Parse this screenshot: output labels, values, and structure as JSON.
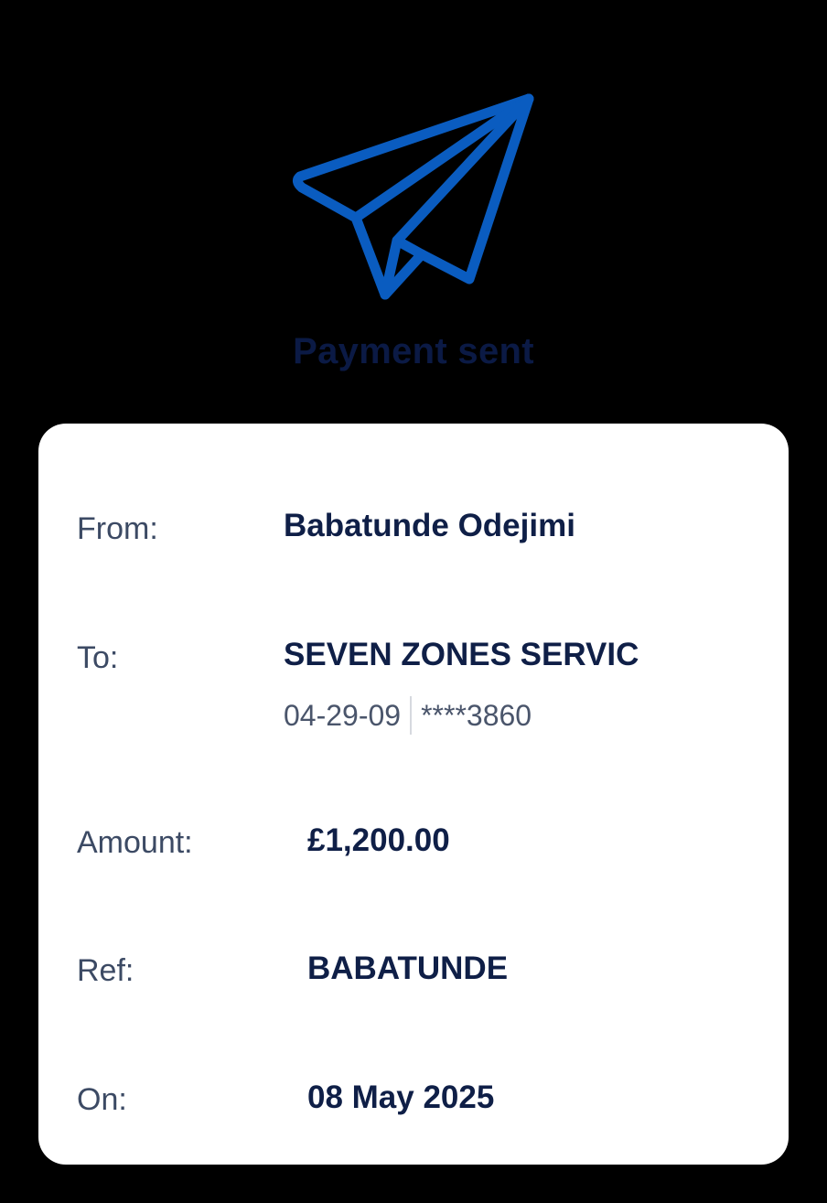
{
  "header": {
    "icon": "paper-plane-icon",
    "title": "Payment sent",
    "accent_color": "#0a5cc0"
  },
  "details": {
    "from": {
      "label": "From:",
      "value": "Babatunde Odejimi"
    },
    "to": {
      "label": "To:",
      "value": "SEVEN ZONES SERVIC",
      "sort_code": "04-29-09",
      "account_number": "****3860"
    },
    "amount": {
      "label": "Amount:",
      "value": "£1,200.00"
    },
    "ref": {
      "label": "Ref:",
      "value": "BABATUNDE"
    },
    "on": {
      "label": "On:",
      "value": "08 May 2025"
    }
  }
}
